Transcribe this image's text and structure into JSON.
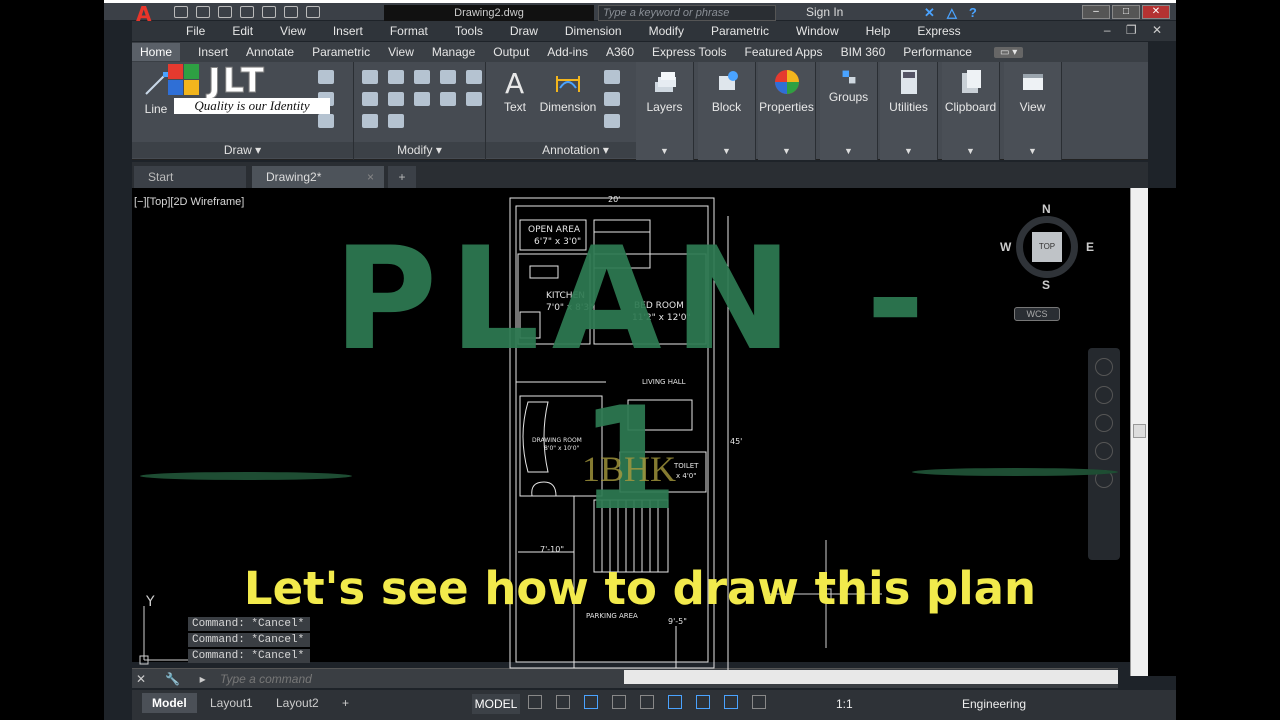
{
  "app": {
    "document_title": "Drawing2.dwg",
    "search_placeholder": "Type a keyword or phrase",
    "sign_in": "Sign In"
  },
  "menu": [
    "File",
    "Edit",
    "View",
    "Insert",
    "Format",
    "Tools",
    "Draw",
    "Dimension",
    "Modify",
    "Parametric",
    "Window",
    "Help",
    "Express"
  ],
  "ribbon_tabs": [
    "Home",
    "Insert",
    "Annotate",
    "Parametric",
    "View",
    "Manage",
    "Output",
    "Add-ins",
    "A360",
    "Express Tools",
    "Featured Apps",
    "BIM 360",
    "Performance"
  ],
  "ribbon": {
    "draw_line_label": "Line",
    "draw_panel": "Draw ▾",
    "modify_panel": "Modify ▾",
    "text_label": "Text",
    "dimension_label": "Dimension",
    "annotation_panel": "Annotation ▾",
    "layers": "Layers",
    "block": "Block",
    "properties": "Properties",
    "groups": "Groups",
    "utilities": "Utilities",
    "clipboard": "Clipboard",
    "view": "View"
  },
  "brand": {
    "wordmark": "JLT",
    "tagline": "Quality is our Identity",
    "colors": [
      "#e53a2f",
      "#2ea043",
      "#2f6fd6",
      "#f2b51d"
    ]
  },
  "doc_tabs": {
    "start": "Start",
    "active": "Drawing2*",
    "close": "×",
    "new": "+"
  },
  "canvas": {
    "viewport_label": "[−][Top][2D Wireframe]",
    "viewcube": {
      "n": "N",
      "s": "S",
      "e": "E",
      "w": "W",
      "face": "TOP",
      "wcs": "WCS"
    },
    "ucs_y": "Y"
  },
  "plan": {
    "top_dim": "20'",
    "right_dim": "45'",
    "open_area": "OPEN AREA",
    "open_area_size": "6'7\" x 3'0\"",
    "kitchen": "KITCHEN",
    "kitchen_size": "7'0\" x 8'3\"",
    "bedroom": "BED ROOM",
    "bedroom_size": "11'2\" x 12'0\"",
    "living": "LIVING HALL",
    "drawing": "DRAWING ROOM",
    "drawing_size": "8'0\" x 10'0\"",
    "toilet": "TOILET",
    "toilet_size": "x 4'0\"",
    "stair_dim": "7'-10\"",
    "parking": "PARKING AREA",
    "parking_dim": "9'-5\""
  },
  "command": {
    "history": [
      "Command: *Cancel*",
      "Command: *Cancel*",
      "Command: *Cancel*"
    ],
    "placeholder": "Type a command"
  },
  "status": {
    "layouts": [
      "Model",
      "Layout1",
      "Layout2",
      "+"
    ],
    "model_space": "MODEL",
    "scale": "1:1",
    "workspace": "Engineering"
  },
  "overlay": {
    "title": "PLAN - 1",
    "bhk": "1BHK",
    "subtitle": "Let's  see  how to draw this plan",
    "title_color": "#2e7a52",
    "subtitle_color": "#f2ea4c"
  }
}
